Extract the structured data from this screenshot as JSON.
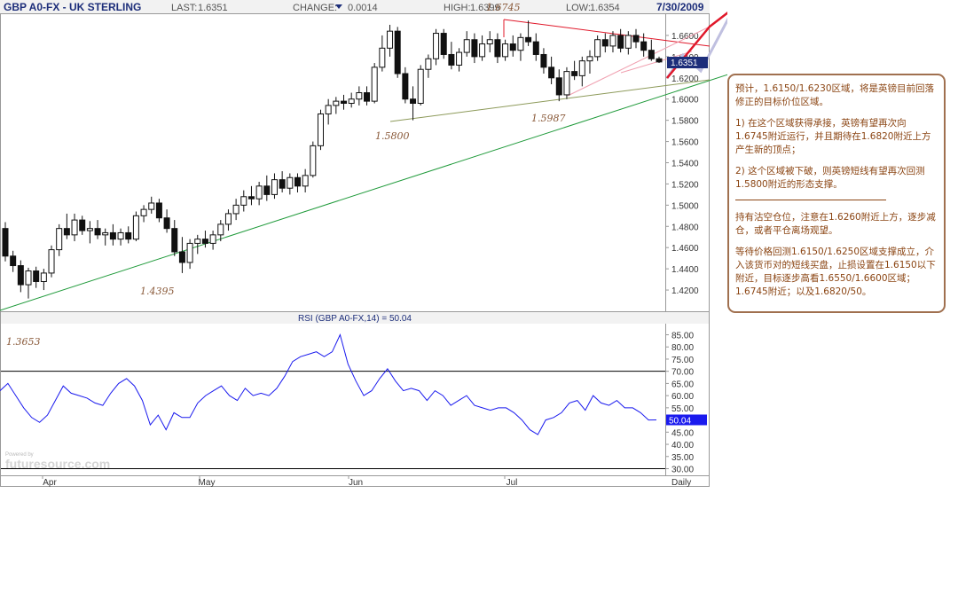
{
  "header": {
    "symbol": "GBP A0-FX - UK STERLING",
    "last_label": "LAST:",
    "last": "1.6351",
    "change_label": "CHANGE:",
    "change": "0.0014",
    "high_label": "HIGH:",
    "high": "1.6399",
    "low_label": "LOW:",
    "low": "1.6354",
    "date": "7/30/2009"
  },
  "price_label": "1.6351",
  "rsi_label": "RSI (GBP A0-FX,14) = 50.04",
  "rsi_value_label": "50.04",
  "period": "Daily",
  "watermark": "futuresource.com",
  "watermark_small": "Powered by",
  "annotations": {
    "a1": "1.6745",
    "a2": "1.5800",
    "a3": "1.5987",
    "a4": "1.4395",
    "a5": "1.3653"
  },
  "colors": {
    "up": "#ffffff",
    "down": "#111111",
    "rsi": "#1a1aee",
    "trend": "#1f9a3a",
    "resistance": "#e0182a",
    "support": "#8d9a5a",
    "label_bg": "#1d2e7a"
  },
  "note": {
    "p1": "预计，1.6150/1.6230区域，将是英镑目前回落修正的目标价位区域。",
    "p2": "1) 在这个区域获得承接，英镑有望再次向1.6745附近运行，并且期待在1.6820附近上方产生新的顶点；",
    "p3": "2) 这个区域被下破，则英镑短线有望再次回测1.5800附近的形态支撑。",
    "p4": "持有沽空仓位，注意在1.6260附近上方，逐步减仓，或者平仓离场观望。",
    "p5": "等待价格回测1.6150/1.6250区域支撑成立，介入该货币对的短线买盘，止损设置在1.6150以下附近，目标逐步高看1.6550/1.6600区域；1.6745附近；以及1.6820/50。"
  },
  "chart_data": [
    {
      "type": "candlestick",
      "title": "GBP A0-FX - UK STERLING",
      "x_labels": [
        "Apr",
        "May",
        "Jun",
        "Jul"
      ],
      "y_ticks": [
        1.42,
        1.44,
        1.46,
        1.48,
        1.5,
        1.52,
        1.54,
        1.56,
        1.58,
        1.6,
        1.62,
        1.64,
        1.66
      ],
      "y_tick_labels": [
        "1.4200",
        "1.4400",
        "1.4600",
        "1.4800",
        "1.5000",
        "1.5200",
        "1.5400",
        "1.5600",
        "1.5800",
        "1.6000",
        "1.6200",
        "1.6400",
        "1.6600"
      ],
      "ylim": [
        1.405,
        1.675
      ],
      "grid": false,
      "ohlc": [
        [
          1.478,
          1.484,
          1.447,
          1.452
        ],
        [
          1.452,
          1.457,
          1.437,
          1.443
        ],
        [
          1.443,
          1.448,
          1.418,
          1.425
        ],
        [
          1.425,
          1.441,
          1.412,
          1.438
        ],
        [
          1.438,
          1.442,
          1.422,
          1.428
        ],
        [
          1.428,
          1.44,
          1.42,
          1.436
        ],
        [
          1.436,
          1.462,
          1.432,
          1.458
        ],
        [
          1.458,
          1.482,
          1.452,
          1.478
        ],
        [
          1.478,
          1.492,
          1.468,
          1.472
        ],
        [
          1.472,
          1.492,
          1.466,
          1.486
        ],
        [
          1.486,
          1.49,
          1.472,
          1.476
        ],
        [
          1.476,
          1.485,
          1.464,
          1.478
        ],
        [
          1.478,
          1.486,
          1.468,
          1.472
        ],
        [
          1.472,
          1.478,
          1.462,
          1.474
        ],
        [
          1.474,
          1.482,
          1.462,
          1.468
        ],
        [
          1.468,
          1.478,
          1.462,
          1.474
        ],
        [
          1.474,
          1.48,
          1.464,
          1.468
        ],
        [
          1.468,
          1.494,
          1.466,
          1.49
        ],
        [
          1.49,
          1.5,
          1.484,
          1.496
        ],
        [
          1.496,
          1.508,
          1.492,
          1.502
        ],
        [
          1.502,
          1.506,
          1.484,
          1.488
        ],
        [
          1.488,
          1.496,
          1.474,
          1.478
        ],
        [
          1.478,
          1.486,
          1.452,
          1.456
        ],
        [
          1.456,
          1.47,
          1.436,
          1.446
        ],
        [
          1.446,
          1.468,
          1.44,
          1.464
        ],
        [
          1.464,
          1.472,
          1.454,
          1.468
        ],
        [
          1.468,
          1.476,
          1.46,
          1.464
        ],
        [
          1.464,
          1.476,
          1.458,
          1.472
        ],
        [
          1.472,
          1.486,
          1.466,
          1.482
        ],
        [
          1.482,
          1.496,
          1.476,
          1.492
        ],
        [
          1.492,
          1.506,
          1.486,
          1.5
        ],
        [
          1.5,
          1.514,
          1.494,
          1.508
        ],
        [
          1.508,
          1.518,
          1.5,
          1.506
        ],
        [
          1.506,
          1.522,
          1.5,
          1.518
        ],
        [
          1.518,
          1.528,
          1.504,
          1.51
        ],
        [
          1.51,
          1.53,
          1.506,
          1.524
        ],
        [
          1.524,
          1.532,
          1.512,
          1.516
        ],
        [
          1.516,
          1.53,
          1.51,
          1.526
        ],
        [
          1.526,
          1.53,
          1.512,
          1.518
        ],
        [
          1.518,
          1.534,
          1.512,
          1.528
        ],
        [
          1.528,
          1.56,
          1.526,
          1.556
        ],
        [
          1.556,
          1.59,
          1.552,
          1.586
        ],
        [
          1.586,
          1.6,
          1.576,
          1.594
        ],
        [
          1.594,
          1.602,
          1.586,
          1.598
        ],
        [
          1.598,
          1.604,
          1.59,
          1.596
        ],
        [
          1.596,
          1.606,
          1.592,
          1.6
        ],
        [
          1.6,
          1.612,
          1.594,
          1.606
        ],
        [
          1.606,
          1.612,
          1.594,
          1.598
        ],
        [
          1.598,
          1.634,
          1.596,
          1.63
        ],
        [
          1.63,
          1.66,
          1.626,
          1.648
        ],
        [
          1.648,
          1.67,
          1.64,
          1.664
        ],
        [
          1.664,
          1.668,
          1.62,
          1.624
        ],
        [
          1.624,
          1.63,
          1.596,
          1.6
        ],
        [
          1.6,
          1.612,
          1.58,
          1.596
        ],
        [
          1.596,
          1.632,
          1.594,
          1.628
        ],
        [
          1.628,
          1.642,
          1.62,
          1.638
        ],
        [
          1.638,
          1.666,
          1.632,
          1.662
        ],
        [
          1.662,
          1.666,
          1.638,
          1.642
        ],
        [
          1.642,
          1.654,
          1.628,
          1.632
        ],
        [
          1.632,
          1.648,
          1.626,
          1.644
        ],
        [
          1.644,
          1.664,
          1.64,
          1.656
        ],
        [
          1.656,
          1.662,
          1.634,
          1.64
        ],
        [
          1.64,
          1.66,
          1.636,
          1.652
        ],
        [
          1.652,
          1.664,
          1.644,
          1.656
        ],
        [
          1.656,
          1.662,
          1.634,
          1.64
        ],
        [
          1.64,
          1.656,
          1.636,
          1.652
        ],
        [
          1.652,
          1.66,
          1.64,
          1.646
        ],
        [
          1.646,
          1.662,
          1.636,
          1.658
        ],
        [
          1.658,
          1.674,
          1.65,
          1.654
        ],
        [
          1.654,
          1.662,
          1.636,
          1.642
        ],
        [
          1.642,
          1.648,
          1.624,
          1.63
        ],
        [
          1.63,
          1.64,
          1.614,
          1.62
        ],
        [
          1.62,
          1.628,
          1.598,
          1.604
        ],
        [
          1.604,
          1.63,
          1.6,
          1.626
        ],
        [
          1.626,
          1.636,
          1.618,
          1.622
        ],
        [
          1.622,
          1.64,
          1.612,
          1.636
        ],
        [
          1.636,
          1.646,
          1.624,
          1.64
        ],
        [
          1.64,
          1.66,
          1.636,
          1.656
        ],
        [
          1.656,
          1.662,
          1.644,
          1.65
        ],
        [
          1.65,
          1.664,
          1.644,
          1.66
        ],
        [
          1.66,
          1.666,
          1.644,
          1.648
        ],
        [
          1.648,
          1.664,
          1.642,
          1.66
        ],
        [
          1.66,
          1.666,
          1.648,
          1.654
        ],
        [
          1.654,
          1.662,
          1.64,
          1.646
        ],
        [
          1.646,
          1.656,
          1.636,
          1.638
        ],
        [
          1.638,
          1.64,
          1.634,
          1.635
        ]
      ],
      "annotations": [
        {
          "text": "1.6745",
          "value": 1.6745
        },
        {
          "text": "1.5800",
          "value": 1.58
        },
        {
          "text": "1.5987",
          "value": 1.5987
        },
        {
          "text": "1.4395",
          "value": 1.4395
        }
      ]
    },
    {
      "type": "line",
      "title": "RSI (GBP A0-FX,14) = 50.04",
      "y_ticks": [
        30,
        35,
        40,
        45,
        50,
        55,
        60,
        65,
        70,
        75,
        80,
        85
      ],
      "ylim": [
        28,
        87
      ],
      "reference_lines": [
        70,
        30
      ],
      "series": [
        {
          "name": "RSI",
          "values": [
            62,
            65,
            60,
            55,
            51,
            49,
            52,
            58,
            64,
            61,
            60,
            59,
            57,
            56,
            61,
            65,
            67,
            64,
            58,
            48,
            52,
            46,
            53,
            51,
            51,
            57,
            60,
            62,
            64,
            60,
            58,
            63,
            60,
            61,
            60,
            63,
            68,
            74,
            76,
            77,
            78,
            76,
            78,
            85,
            73,
            66,
            60,
            62,
            67,
            71,
            66,
            62,
            63,
            62,
            58,
            62,
            60,
            56,
            58,
            60,
            56,
            55,
            54,
            55,
            55,
            53,
            50,
            46,
            44,
            50,
            51,
            53,
            57,
            58,
            54,
            60,
            57,
            56,
            58,
            55,
            55,
            53,
            50,
            50.04
          ]
        }
      ]
    }
  ]
}
